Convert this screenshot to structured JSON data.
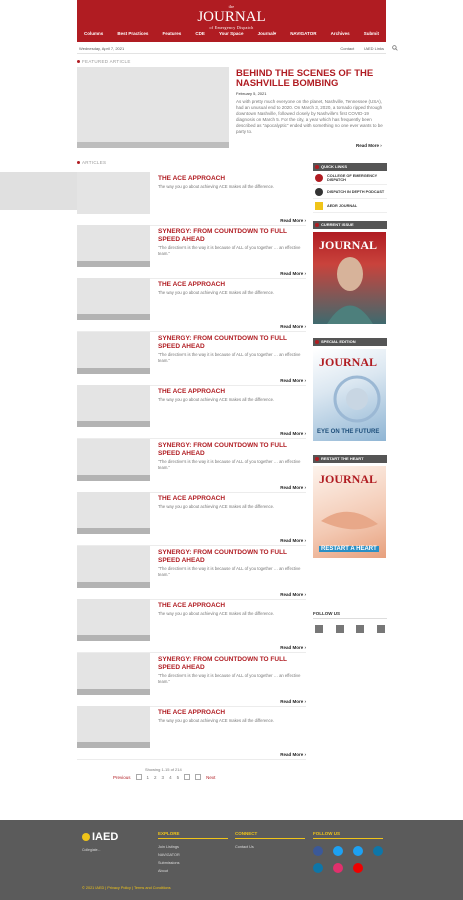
{
  "header": {
    "logo_small": "the",
    "logo_title": "JOURNAL",
    "logo_sub": "of Emergency Dispatch",
    "nav": [
      "Columns",
      "Best Practices",
      "Features",
      "CDE",
      "Your Space",
      "Journal▾",
      "NAVIGATOR",
      "Archives",
      "Submit"
    ]
  },
  "util": {
    "date": "Wednesday, April 7, 2021",
    "links": [
      "Contact",
      "IAED Links"
    ]
  },
  "featured": {
    "heading": "FEATURED ARTICLE",
    "title": "BEHIND THE SCENES OF THE NASHVILLE BOMBING",
    "date": "February 5, 2021",
    "excerpt": "As with pretty much everyone on the planet, Nashville, Tennessee (USA), had an unusual end to 2020. On March 3, 2020, a tornado ripped through downtown Nashville, followed closely by Nashville's first COVID-19 diagnosis on March 5. For the city, a year which has frequently been described as \"apocalyptic\" ended with something no one ever wants to be party to.",
    "read_more": "Read More ›"
  },
  "articles_heading": "ARTICLES",
  "articles": [
    {
      "title": "THE ACE APPROACH",
      "excerpt": "The way you go about achieving ACE makes all the difference.",
      "read_more": "Read More ›"
    },
    {
      "title": "SYNERGY: FROM COUNTDOWN TO FULL SPEED AHEAD",
      "excerpt": "\"The directive's is the way it is because of ALL of you together … an effective team.\"",
      "read_more": "Read More ›"
    },
    {
      "title": "THE ACE APPROACH",
      "excerpt": "The way you go about achieving ACE makes all the difference.",
      "read_more": "Read More ›"
    },
    {
      "title": "SYNERGY: FROM COUNTDOWN TO FULL SPEED AHEAD",
      "excerpt": "\"The directive's is the way it is because of ALL of you together … an effective team.\"",
      "read_more": "Read More ›"
    },
    {
      "title": "THE ACE APPROACH",
      "excerpt": "The way you go about achieving ACE makes all the difference.",
      "read_more": "Read More ›"
    },
    {
      "title": "SYNERGY: FROM COUNTDOWN TO FULL SPEED AHEAD",
      "excerpt": "\"The directive's is the way it is because of ALL of you together … an effective team.\"",
      "read_more": "Read More ›"
    },
    {
      "title": "THE ACE APPROACH",
      "excerpt": "The way you go about achieving ACE makes all the difference.",
      "read_more": "Read More ›"
    },
    {
      "title": "SYNERGY: FROM COUNTDOWN TO FULL SPEED AHEAD",
      "excerpt": "\"The directive's is the way it is because of ALL of you together … an effective team.\"",
      "read_more": "Read More ›"
    },
    {
      "title": "THE ACE APPROACH",
      "excerpt": "The way you go about achieving ACE makes all the difference.",
      "read_more": "Read More ›"
    },
    {
      "title": "SYNERGY: FROM COUNTDOWN TO FULL SPEED AHEAD",
      "excerpt": "\"The directive's is the way it is because of ALL of you together … an effective team.\"",
      "read_more": "Read More ›"
    },
    {
      "title": "THE ACE APPROACH",
      "excerpt": "The way you go about achieving ACE makes all the difference.",
      "read_more": "Read More ›"
    }
  ],
  "rail": {
    "quick_links": {
      "heading": "QUICK LINKS",
      "items": [
        "COLLEGE OF EMERGENCY DISPATCH",
        "DISPATCH IN DEPTH PODCAST",
        "AEDR JOURNAL"
      ]
    },
    "current_issue": {
      "heading": "CURRENT ISSUE",
      "cover_title": "JOURNAL"
    },
    "special_edition": {
      "heading": "SPECIAL EDITION",
      "cover_title": "JOURNAL",
      "cover_text": "EYE ON THE FUTURE"
    },
    "restart": {
      "heading": "RESTART THE HEART",
      "cover_title": "JOURNAL",
      "cover_text": "RESTART A HEART"
    },
    "follow": {
      "heading": "FOLLOW US"
    }
  },
  "pager": {
    "showing": "Showing 1-15 of 214",
    "prev": "Previous",
    "pages": [
      "1",
      "2",
      "3",
      "4",
      "5"
    ],
    "next": "Next"
  },
  "footer": {
    "logo": "IAED",
    "tagline": "Collegiate...",
    "cols": [
      {
        "h": "EXPLORE",
        "items": [
          "Join Listings",
          "NAVIGATOR",
          "Submissions",
          "About"
        ]
      },
      {
        "h": "CONNECT",
        "items": [
          "Contact Us"
        ]
      },
      {
        "h": "FOLLOW US",
        "items": []
      }
    ],
    "copyright": "© 2021 IAED | Privacy Policy | Terms and Conditions",
    "colors": {
      "bg": "#5b5b5b",
      "accent": "#f0c419"
    }
  },
  "colors": {
    "brand": "#b01c22"
  }
}
